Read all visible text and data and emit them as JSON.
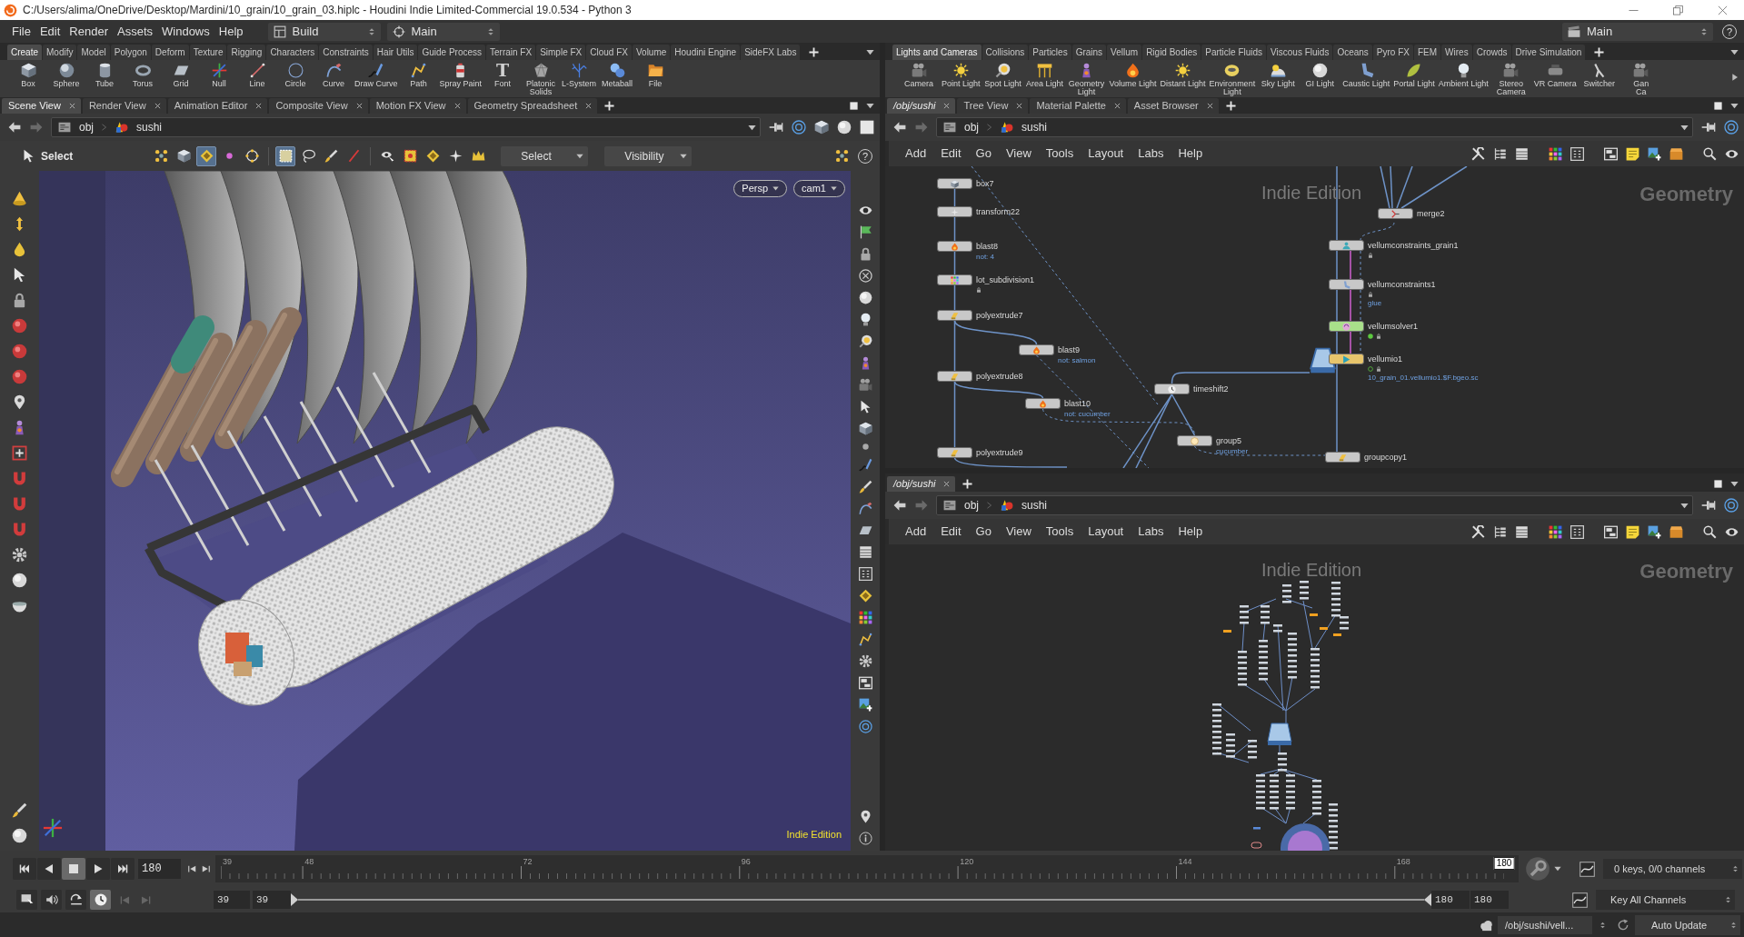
{
  "window": {
    "title": "C:/Users/alima/OneDrive/Desktop/Mardini/10_grain/10_grain_03.hiplc - Houdini Indie Limited-Commercial 19.0.534 - Python 3"
  },
  "menu_bar": {
    "items": [
      "File",
      "Edit",
      "Render",
      "Assets",
      "Windows",
      "Help"
    ],
    "desktop": "Build",
    "main_menu": "Main",
    "right_menu": "Main",
    "help": "?"
  },
  "shelves": [
    {
      "tabs": [
        {
          "label": "Create",
          "selected": true
        },
        {
          "label": "Modify",
          "selected": false
        },
        {
          "label": "Model",
          "selected": false
        },
        {
          "label": "Polygon",
          "selected": false
        },
        {
          "label": "Deform",
          "selected": false
        },
        {
          "label": "Texture",
          "selected": false
        },
        {
          "label": "Rigging",
          "selected": false
        },
        {
          "label": "Characters",
          "selected": false
        },
        {
          "label": "Constraints",
          "selected": false
        },
        {
          "label": "Hair Utils",
          "selected": false
        },
        {
          "label": "Guide Process",
          "selected": false
        },
        {
          "label": "Terrain FX",
          "selected": false
        },
        {
          "label": "Simple FX",
          "selected": false
        },
        {
          "label": "Cloud FX",
          "selected": false
        },
        {
          "label": "Volume",
          "selected": false
        },
        {
          "label": "Houdini Engine",
          "selected": false
        },
        {
          "label": "SideFX Labs",
          "selected": false
        }
      ],
      "tools": [
        {
          "lines": [
            "Box"
          ]
        },
        {
          "lines": [
            "Sphere"
          ]
        },
        {
          "lines": [
            "Tube"
          ]
        },
        {
          "lines": [
            "Torus"
          ]
        },
        {
          "lines": [
            "Grid"
          ]
        },
        {
          "lines": [
            "Null"
          ]
        },
        {
          "lines": [
            "Line"
          ]
        },
        {
          "lines": [
            "Circle"
          ]
        },
        {
          "lines": [
            "Curve"
          ]
        },
        {
          "lines": [
            "Draw Curve"
          ]
        },
        {
          "lines": [
            "Path"
          ]
        },
        {
          "lines": [
            "Spray Paint"
          ]
        },
        {
          "lines": [
            "Font"
          ],
          "glyph": "T"
        },
        {
          "lines": [
            "Platonic",
            "Solids"
          ]
        },
        {
          "lines": [
            "L-System"
          ]
        },
        {
          "lines": [
            "Metaball"
          ]
        },
        {
          "lines": [
            "File"
          ]
        }
      ]
    },
    {
      "tabs": [
        {
          "label": "Lights and Cameras",
          "selected": true
        },
        {
          "label": "Collisions",
          "selected": false
        },
        {
          "label": "Particles",
          "selected": false
        },
        {
          "label": "Grains",
          "selected": false
        },
        {
          "label": "Vellum",
          "selected": false
        },
        {
          "label": "Rigid Bodies",
          "selected": false
        },
        {
          "label": "Particle Fluids",
          "selected": false
        },
        {
          "label": "Viscous Fluids",
          "selected": false
        },
        {
          "label": "Oceans",
          "selected": false
        },
        {
          "label": "Pyro FX",
          "selected": false
        },
        {
          "label": "FEM",
          "selected": false
        },
        {
          "label": "Wires",
          "selected": false
        },
        {
          "label": "Crowds",
          "selected": false
        },
        {
          "label": "Drive Simulation",
          "selected": false
        }
      ],
      "tools": [
        {
          "lines": [
            "Camera"
          ]
        },
        {
          "lines": [
            "Point Light"
          ]
        },
        {
          "lines": [
            "Spot Light"
          ]
        },
        {
          "lines": [
            "Area Light"
          ]
        },
        {
          "lines": [
            "Geometry",
            "Light"
          ]
        },
        {
          "lines": [
            "Volume Light"
          ]
        },
        {
          "lines": [
            "Distant Light"
          ]
        },
        {
          "lines": [
            "Environment",
            "Light"
          ]
        },
        {
          "lines": [
            "Sky Light"
          ]
        },
        {
          "lines": [
            "GI Light"
          ]
        },
        {
          "lines": [
            "Caustic Light"
          ]
        },
        {
          "lines": [
            "Portal Light"
          ]
        },
        {
          "lines": [
            "Ambient Light"
          ]
        },
        {
          "lines": [
            "Stereo",
            "Camera"
          ]
        },
        {
          "lines": [
            "VR Camera"
          ]
        },
        {
          "lines": [
            "Switcher"
          ]
        },
        {
          "lines": [
            "Gan",
            "Ca"
          ]
        }
      ]
    }
  ],
  "scene_view": {
    "tabs": [
      {
        "label": "Scene View",
        "selected": true
      },
      {
        "label": "Render View",
        "selected": false
      },
      {
        "label": "Animation Editor",
        "selected": false
      },
      {
        "label": "Composite View",
        "selected": false
      },
      {
        "label": "Motion FX View",
        "selected": false
      },
      {
        "label": "Geometry Spreadsheet",
        "selected": false
      }
    ],
    "path": [
      "obj",
      "sushi"
    ],
    "toolbar": {
      "label": "Select",
      "tools": [
        {
          "selected": false
        },
        {
          "selected": false
        },
        {
          "selected": true
        },
        {
          "selected": false
        },
        {
          "selected": false
        },
        {
          "selected": true
        },
        {
          "selected": false
        },
        {
          "selected": false
        },
        {
          "selected": false
        },
        {
          "selected": false
        },
        {
          "selected": false
        },
        {
          "selected": false
        },
        {
          "selected": false
        },
        {
          "selected": false
        }
      ],
      "dropdowns": [
        "Select",
        "Visibility"
      ],
      "help": "?"
    },
    "viewport": {
      "camera_menus": [
        "Persp",
        "cam1"
      ],
      "watermark": "Indie Edition"
    }
  },
  "network_top": {
    "tabs": [
      {
        "label": "/obj/sushi",
        "selected": true
      },
      {
        "label": "Tree View",
        "selected": false
      },
      {
        "label": "Material Palette",
        "selected": false
      },
      {
        "label": "Asset Browser",
        "selected": false
      }
    ],
    "path": [
      "obj",
      "sushi"
    ],
    "menu": [
      "Add",
      "Edit",
      "Go",
      "View",
      "Tools",
      "Layout",
      "Labs",
      "Help"
    ],
    "watermark": "Indie Edition",
    "context": "Geometry",
    "nodes": [
      {
        "name": "box7",
        "color": "#c8c8c8",
        "locked": false,
        "cached": false,
        "dot": false
      },
      {
        "name": "transform22",
        "color": "#c8c8c8",
        "locked": false,
        "cached": false,
        "dot": false
      },
      {
        "name": "blast8",
        "color": "#c8c8c8",
        "locked": false,
        "cached": false,
        "dot": false,
        "note": "not: 4"
      },
      {
        "name": "lot_subdivision1",
        "color": "#c8c8c8",
        "locked": true,
        "cached": false,
        "dot": false
      },
      {
        "name": "polyextrude7",
        "color": "#c8c8c8",
        "locked": false,
        "cached": false,
        "dot": false
      },
      {
        "name": "blast9",
        "color": "#c8c8c8",
        "locked": false,
        "cached": false,
        "dot": false,
        "note": "not: salmon"
      },
      {
        "name": "polyextrude8",
        "color": "#c8c8c8",
        "locked": false,
        "cached": false,
        "dot": false
      },
      {
        "name": "blast10",
        "color": "#c8c8c8",
        "locked": false,
        "cached": false,
        "dot": false,
        "note": "not: cucumber"
      },
      {
        "name": "polyextrude9",
        "color": "#c8c8c8",
        "locked": false,
        "cached": false,
        "dot": false
      },
      {
        "name": "timeshift2",
        "color": "#c8c8c8",
        "locked": false,
        "cached": false,
        "dot": false
      },
      {
        "name": "group5",
        "color": "#c8c8c8",
        "locked": false,
        "cached": false,
        "dot": false,
        "note": "cucumber"
      },
      {
        "name": "merge2",
        "color": "#c8c8c8",
        "locked": false,
        "cached": false,
        "dot": false
      },
      {
        "name": "vellumconstraints_grain1",
        "color": "#c8c8c8",
        "locked": true,
        "cached": false,
        "dot": false
      },
      {
        "name": "vellumconstraints1",
        "color": "#c8c8c8",
        "locked": true,
        "cached": false,
        "dot": false,
        "note": "glue"
      },
      {
        "name": "vellumsolver1",
        "color": "#a9e08a",
        "locked": true,
        "cached": false,
        "dot": true,
        "dot_filled": true
      },
      {
        "name": "vellumio1",
        "color": "#e8c56c",
        "locked": true,
        "cached": true,
        "dot": true,
        "dot_filled": false,
        "note": "10_grain_01.vellumio1.$F.bgeo.sc"
      },
      {
        "name": "groupcopy1",
        "color": "#c8c8c8",
        "locked": false,
        "cached": false,
        "dot": false
      }
    ]
  },
  "network_bottom": {
    "tabs": [
      {
        "label": "/obj/sushi",
        "selected": true
      }
    ],
    "path": [
      "obj",
      "sushi"
    ],
    "menu": [
      "Add",
      "Edit",
      "Go",
      "View",
      "Tools",
      "Layout",
      "Labs",
      "Help"
    ],
    "watermark": "Indie Edition",
    "context": "Geometry"
  },
  "timeline": {
    "playback": [
      {
        "selected": false
      },
      {
        "selected": false
      },
      {
        "selected": true
      },
      {
        "selected": false
      },
      {
        "selected": false
      }
    ],
    "current_frame": "180",
    "ruler_labels": [
      "39",
      "48",
      "72",
      "96",
      "120",
      "144",
      "168"
    ],
    "playhead": {
      "label": "180",
      "level": 1
    },
    "options": [
      {
        "selected": false
      },
      {
        "selected": false
      },
      {
        "selected": false
      },
      {
        "selected": true
      }
    ],
    "range_start": [
      "39",
      "39"
    ],
    "range_bar": {
      "level": 1
    },
    "range_end": [
      "180",
      "180"
    ],
    "keys_info": "0 keys, 0/0 channels",
    "key_menu": "Key All Channels"
  },
  "status_bar": {
    "path": "/obj/sushi/vell...",
    "update_mode": "Auto Update"
  }
}
